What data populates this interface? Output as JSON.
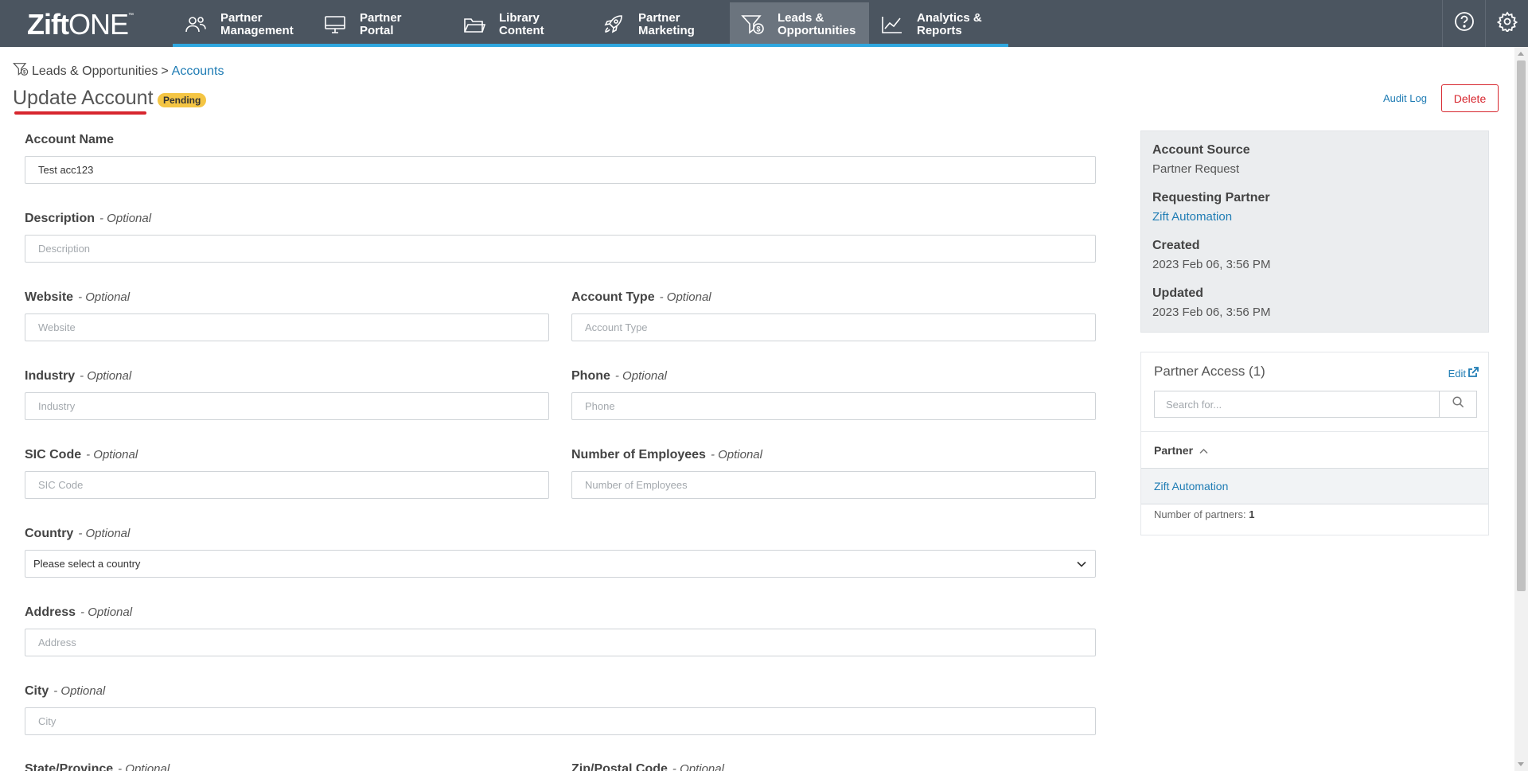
{
  "app": {
    "logo": {
      "bold": "Zift",
      "light": "ONE",
      "tm": "™"
    }
  },
  "nav": {
    "tabs": [
      {
        "label": "Partner\nManagement",
        "icon": "users-icon"
      },
      {
        "label": "Partner\nPortal",
        "icon": "monitor-icon"
      },
      {
        "label": "Library\nContent",
        "icon": "folder-icon"
      },
      {
        "label": "Partner\nMarketing",
        "icon": "rocket-icon"
      },
      {
        "label": "Leads &\nOpportunities",
        "icon": "funnel-dollar-icon",
        "active": true
      },
      {
        "label": "Analytics &\nReports",
        "icon": "line-chart-icon"
      }
    ],
    "right_icons": [
      "help-icon",
      "gear-icon"
    ]
  },
  "breadcrumb": {
    "parent": "Leads & Opportunities",
    "separator": ">",
    "current": "Accounts"
  },
  "page": {
    "title": "Update Account",
    "status_badge": "Pending",
    "audit_log": "Audit Log",
    "delete": "Delete"
  },
  "form": {
    "optional_suffix": "- Optional",
    "account_name": {
      "label": "Account Name",
      "value": "Test acc123"
    },
    "description": {
      "label": "Description",
      "placeholder": "Description"
    },
    "website": {
      "label": "Website",
      "placeholder": "Website"
    },
    "account_type": {
      "label": "Account Type",
      "placeholder": "Account Type"
    },
    "industry": {
      "label": "Industry",
      "placeholder": "Industry"
    },
    "phone": {
      "label": "Phone",
      "placeholder": "Phone"
    },
    "sic_code": {
      "label": "SIC Code",
      "placeholder": "SIC Code"
    },
    "employees": {
      "label": "Number of Employees",
      "placeholder": "Number of Employees"
    },
    "country": {
      "label": "Country",
      "selected": "Please select a country"
    },
    "address": {
      "label": "Address",
      "placeholder": "Address"
    },
    "city": {
      "label": "City",
      "placeholder": "City"
    },
    "state": {
      "label": "State/Province"
    },
    "zip": {
      "label": "Zip/Postal Code"
    }
  },
  "info": {
    "account_source": {
      "label": "Account Source",
      "value": "Partner Request"
    },
    "requesting_partner": {
      "label": "Requesting Partner",
      "value": "Zift Automation"
    },
    "created": {
      "label": "Created",
      "value": "2023 Feb 06, 3:56 PM"
    },
    "updated": {
      "label": "Updated",
      "value": "2023 Feb 06, 3:56 PM"
    }
  },
  "partner_access": {
    "title": "Partner Access (1)",
    "edit": "Edit",
    "search_placeholder": "Search for...",
    "column_header": "Partner",
    "rows": [
      "Zift Automation"
    ],
    "count_label": "Number of partners:",
    "count": "1"
  },
  "colors": {
    "nav_bg": "#4b5560",
    "nav_active": "#6b747e",
    "nav_accent": "#2fa7df",
    "link": "#1f7cb4",
    "danger": "#d7262e",
    "badge": "#f4c544"
  }
}
